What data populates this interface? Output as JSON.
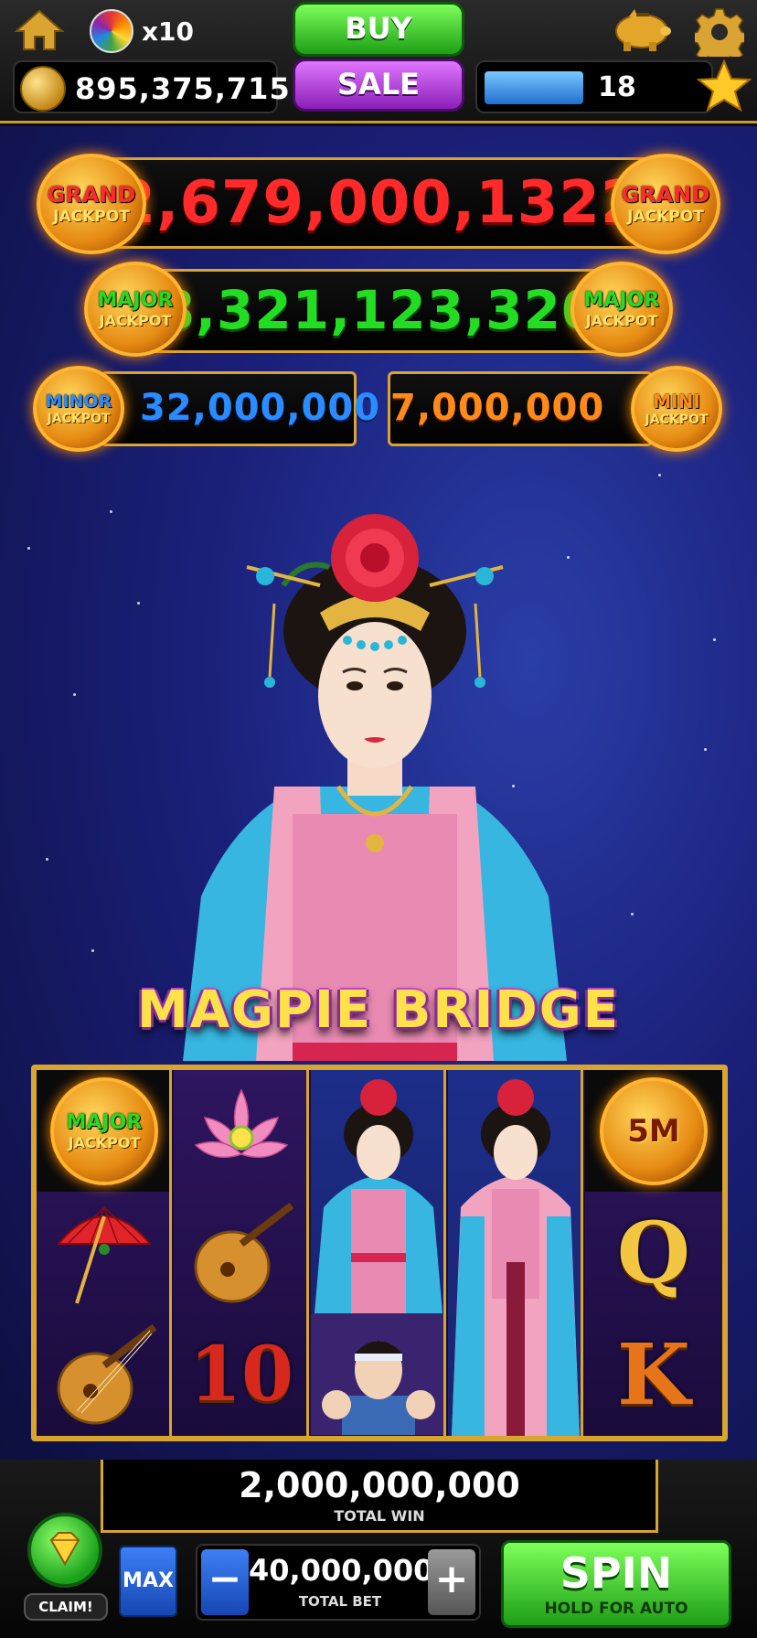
{
  "header": {
    "wheel_count": "x10",
    "coins": "895,375,715",
    "buy_label": "BUY",
    "sale_label": "SALE",
    "level": "18",
    "xp_progress_fraction": 0.45
  },
  "jackpots": {
    "grand": {
      "label_top": "GRAND",
      "label_bottom": "JACKPOT",
      "value": "2,679,000,1322",
      "color": "#ff2a2a"
    },
    "major": {
      "label_top": "MAJOR",
      "label_bottom": "JACKPOT",
      "value": "8,321,123,320",
      "color": "#22dd22"
    },
    "minor": {
      "label_top": "MINOR",
      "label_bottom": "JACKPOT",
      "value": "32,000,000",
      "color": "#2b8cff"
    },
    "mini": {
      "label_top": "MINI",
      "label_bottom": "JACKPOT",
      "value": "7,000,000",
      "color": "#ff8a1a"
    }
  },
  "game_title": "MAGPIE BRIDGE",
  "reels": {
    "reel1": [
      "MAJOR JACKPOT",
      "parasol",
      "pipa"
    ],
    "reel2": [
      "lotus",
      "pipa",
      "10"
    ],
    "reel3": [
      "lady",
      "lady",
      "family"
    ],
    "reel4": [
      "lady",
      "lady",
      "lady"
    ],
    "reel5": [
      "5M",
      "Q",
      "K"
    ],
    "symbols": {
      "major_top": "MAJOR",
      "major_bottom": "JACKPOT",
      "ten": "10",
      "five_m": "5M",
      "queen": "Q",
      "king": "K"
    }
  },
  "footer": {
    "total_win_value": "2,000,000,000",
    "total_win_label": "TOTAL WIN",
    "claim_label": "CLAIM!",
    "max_label": "MAX",
    "minus_label": "−",
    "plus_label": "+",
    "total_bet_value": "40,000,000",
    "total_bet_label": "TOTAL BET",
    "spin_label": "SPIN",
    "spin_sub": "HOLD FOR AUTO"
  },
  "colors": {
    "gold_border": "#d8a62f",
    "spin_green": "#1e9e16",
    "sale_purple": "#8a1fb8",
    "bg_blue": "#1a1f78"
  }
}
